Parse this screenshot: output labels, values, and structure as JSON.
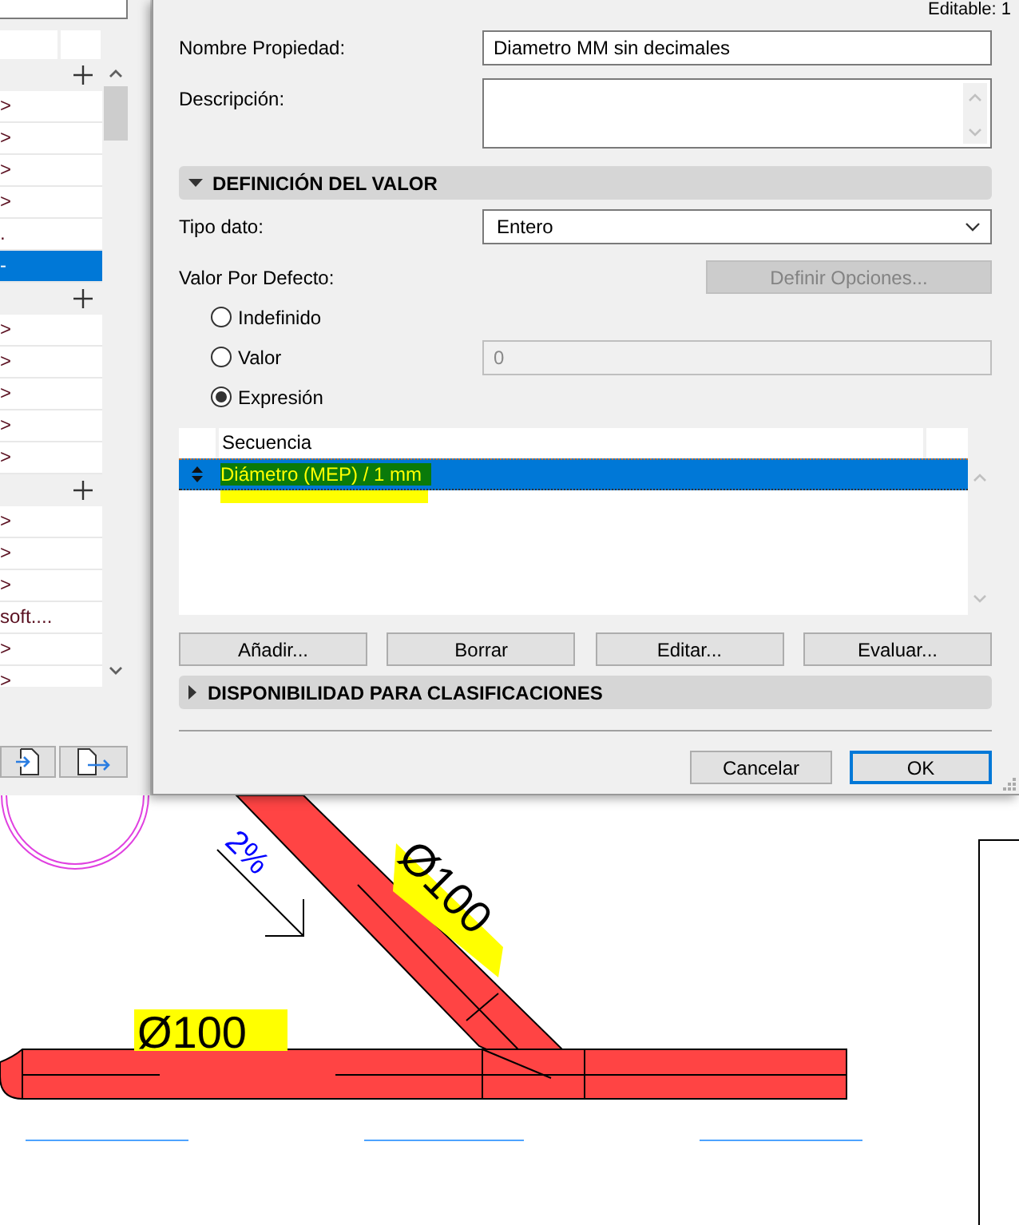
{
  "left_panel": {
    "groups": [
      {
        "rows": [
          {
            "text": ">",
            "selected": false
          },
          {
            "text": ">",
            "selected": false
          },
          {
            "text": ">",
            "selected": false
          },
          {
            "text": ">",
            "selected": false
          },
          {
            "text": ".",
            "selected": false
          },
          {
            "text": "-",
            "selected": true
          }
        ]
      },
      {
        "rows": [
          {
            "text": ">",
            "selected": false
          },
          {
            "text": ">",
            "selected": false
          },
          {
            "text": ">",
            "selected": false
          },
          {
            "text": ">",
            "selected": false
          },
          {
            "text": ">",
            "selected": false
          }
        ]
      },
      {
        "rows": [
          {
            "text": ">",
            "selected": false
          },
          {
            "text": ">",
            "selected": false
          },
          {
            "text": ">",
            "selected": false
          },
          {
            "text": "soft....",
            "selected": false
          },
          {
            "text": ">",
            "selected": false
          },
          {
            "text": ">",
            "selected": false
          }
        ]
      }
    ]
  },
  "dialog": {
    "editable": "Editable: 1",
    "name_label": "Nombre Propiedad:",
    "name_value": "Diametro MM sin decimales",
    "description_label": "Descripción:",
    "value_section": {
      "title": "DEFINICIÓN DEL VALOR",
      "expanded": true
    },
    "type_label": "Tipo dato:",
    "type_value": "Entero",
    "default_label": "Valor Por Defecto:",
    "options_button": {
      "label": "Definir Opciones...",
      "disabled": true
    },
    "radios": [
      {
        "label": "Indefinido",
        "selected": false
      },
      {
        "label": "Valor",
        "selected": false,
        "field": "0"
      },
      {
        "label": "Expresión",
        "selected": true
      }
    ],
    "sequence_table": {
      "column": "Secuencia",
      "rows": [
        {
          "text": "Diámetro (MEP) / 1 mm",
          "selected": true
        }
      ]
    },
    "action_buttons": [
      "Añadir...",
      "Borrar",
      "Editar...",
      "Evaluar..."
    ],
    "classification_section": {
      "title": "DISPONIBILIDAD PARA CLASIFICACIONES",
      "expanded": false
    },
    "cancel_button": "Cancelar",
    "ok_button": "OK"
  },
  "drawing": {
    "slope_label": "2%",
    "diameter_labels": [
      "Ø100",
      "Ø100"
    ]
  }
}
